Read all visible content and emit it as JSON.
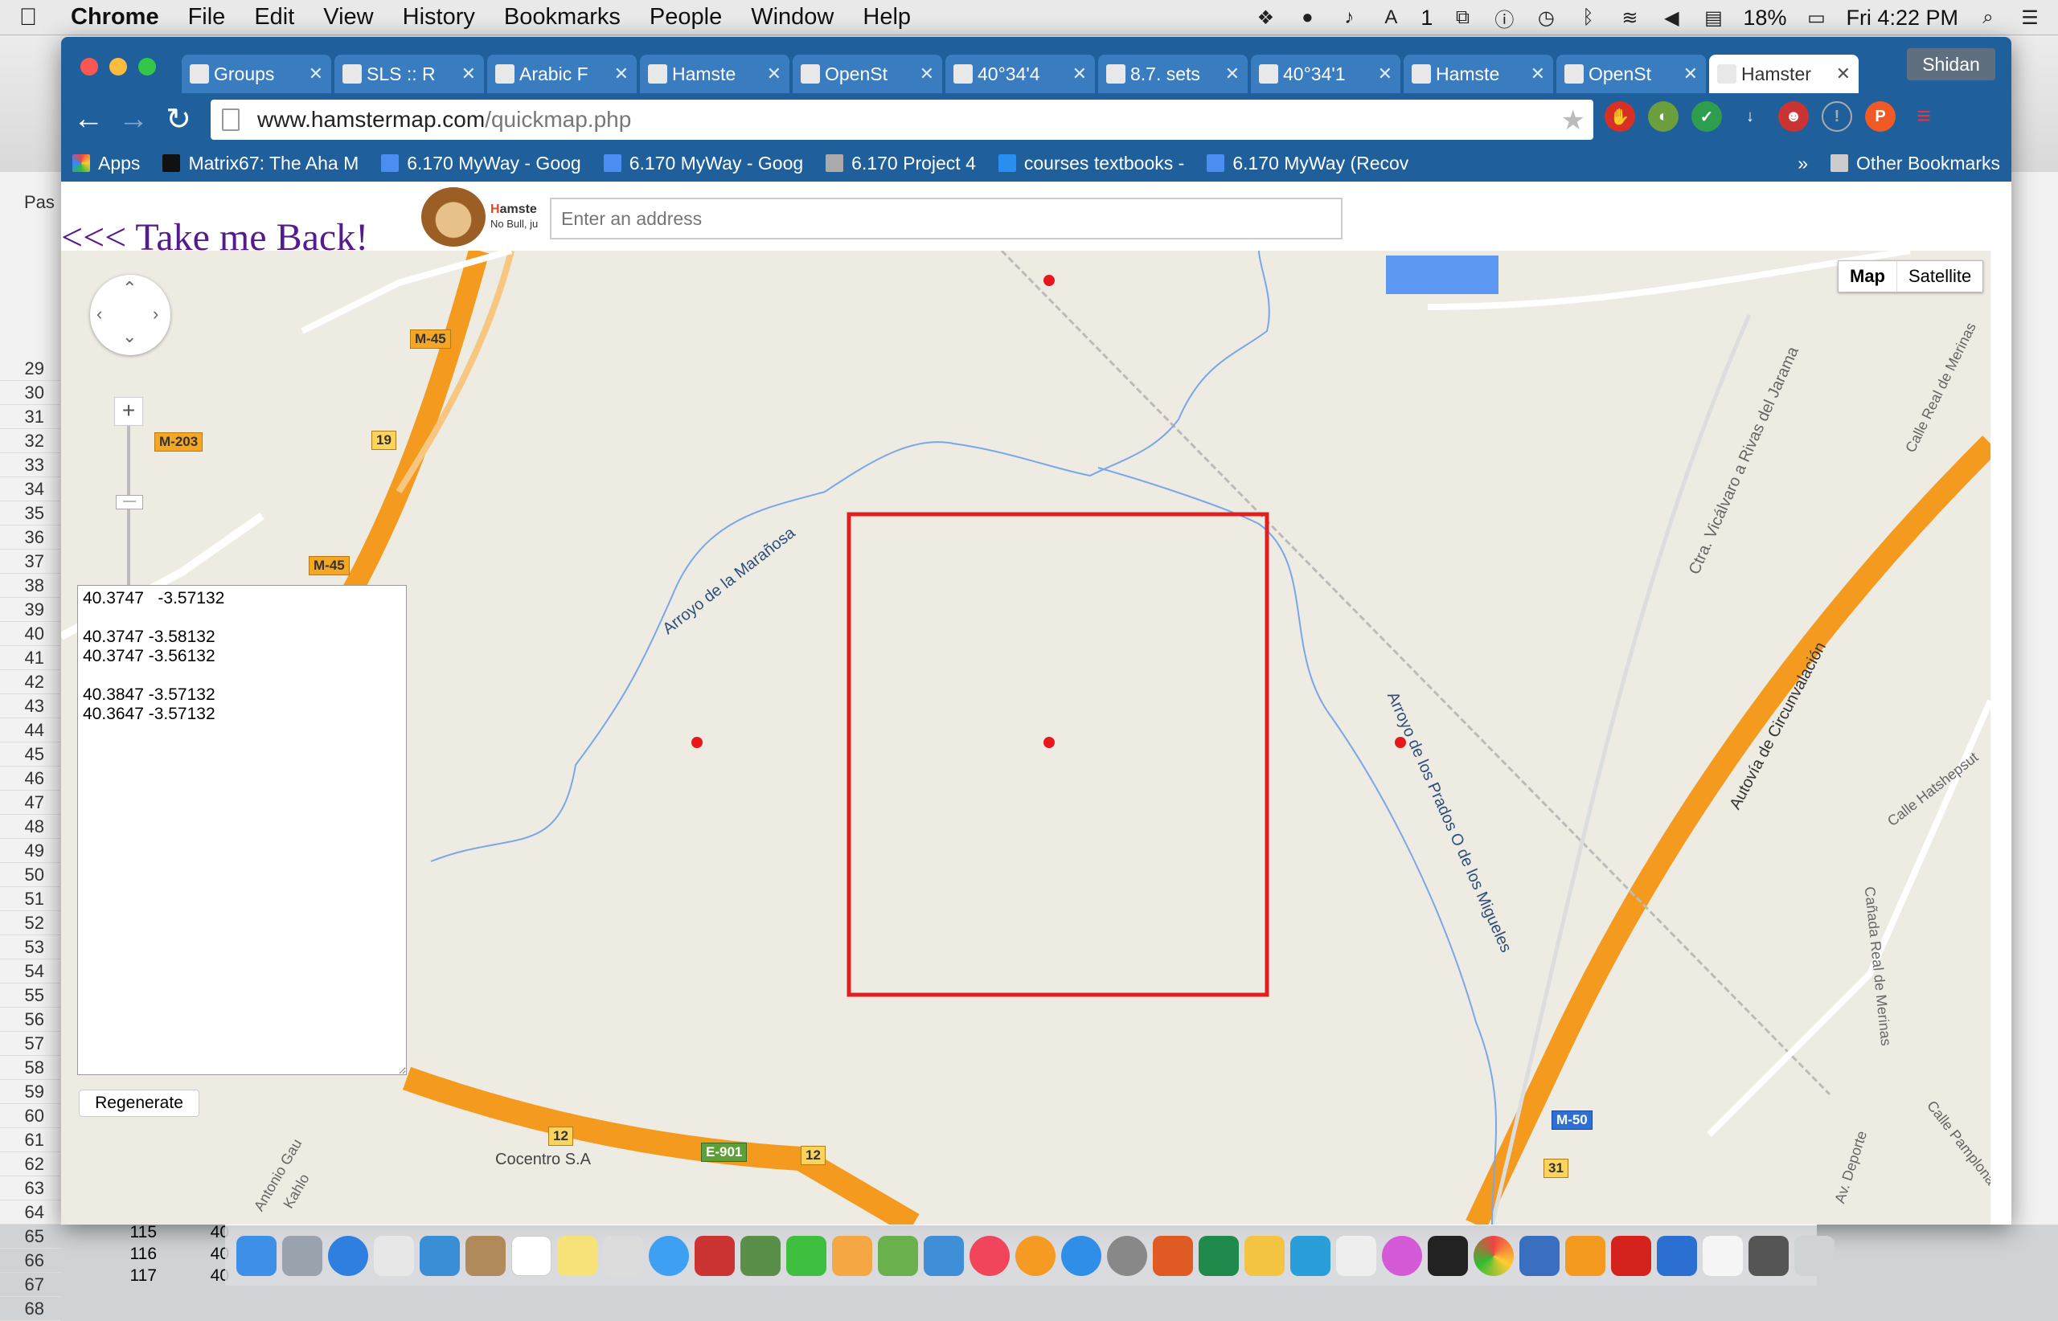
{
  "menubar": {
    "app_name": "Chrome",
    "items": [
      "File",
      "Edit",
      "View",
      "History",
      "Bookmarks",
      "People",
      "Window",
      "Help"
    ],
    "status": {
      "battery": "18%",
      "clock": "Fri 4:22 PM",
      "notif_count": "1"
    }
  },
  "background_app": {
    "paste_label": "Pas",
    "row_numbers": [
      "29",
      "30",
      "31",
      "32",
      "33",
      "34",
      "35",
      "36",
      "37",
      "38",
      "39",
      "40",
      "41",
      "42",
      "43",
      "44",
      "45",
      "46",
      "47",
      "48",
      "49",
      "50",
      "51",
      "52",
      "53",
      "54",
      "55",
      "56",
      "57",
      "58",
      "59",
      "60",
      "61",
      "62",
      "63",
      "64",
      "65",
      "66",
      "67",
      "68"
    ],
    "bottom_rows": [
      [
        "115",
        "40"
      ],
      [
        "116",
        "40"
      ],
      [
        "117",
        "40"
      ]
    ]
  },
  "browser": {
    "profile_name": "Shidan",
    "tabs": [
      {
        "title": "Groups",
        "active": false
      },
      {
        "title": "SLS :: R",
        "active": false
      },
      {
        "title": "Arabic F",
        "active": false
      },
      {
        "title": "Hamste",
        "active": false
      },
      {
        "title": "OpenSt",
        "active": false
      },
      {
        "title": "40°34'4",
        "active": false
      },
      {
        "title": "8.7. sets",
        "active": false
      },
      {
        "title": "40°34'1",
        "active": false
      },
      {
        "title": "Hamste",
        "active": false
      },
      {
        "title": "OpenSt",
        "active": false
      },
      {
        "title": "Hamster",
        "active": true
      }
    ],
    "url_host": "www.hamstermap.com",
    "url_path": "/quickmap.php",
    "bookmarks": [
      "Apps",
      "Matrix67: The Aha M",
      "6.170 MyWay - Goog",
      "6.170 MyWay - Goog",
      "6.170 Project 4",
      "courses textbooks -",
      "6.170 MyWay (Recov"
    ],
    "bookmarks_overflow": "»",
    "other_bookmarks": "Other Bookmarks"
  },
  "page": {
    "back_link": "<<< Take me Back!",
    "logo_line1_h": "H",
    "logo_line1_rest": "amste",
    "logo_line2": "No Bull, ju",
    "address_placeholder": "Enter an address",
    "map_type": {
      "map": "Map",
      "satellite": "Satellite"
    },
    "coords_text": "40.3747   -3.57132\n\n40.3747 -3.58132\n40.3747 -3.56132\n\n40.3847 -3.57132\n40.3647 -3.57132",
    "regenerate_label": "Regenerate",
    "map_labels": {
      "river1": "Arroyo de la Marañosa",
      "river2": "Arroyo de los Prados O de los Migueles",
      "road1": "Ctra. Vicálvaro a Rivas del Jarama",
      "road2": "Autovía de Circunvalación",
      "road3": "Calle Real de Merinas",
      "road4": "Calle Hatshepsut",
      "road5": "Cañada Real de Merinas",
      "road6": "Calle Pamplona",
      "road7": "Av. Deporte",
      "road8": "Antonio Gau",
      "road9": "Kahlo",
      "place": "Cocentro S.A"
    },
    "shields": [
      "M-45",
      "M-203",
      "19",
      "M-45",
      "12",
      "E-901",
      "12",
      "M-50",
      "31"
    ]
  }
}
